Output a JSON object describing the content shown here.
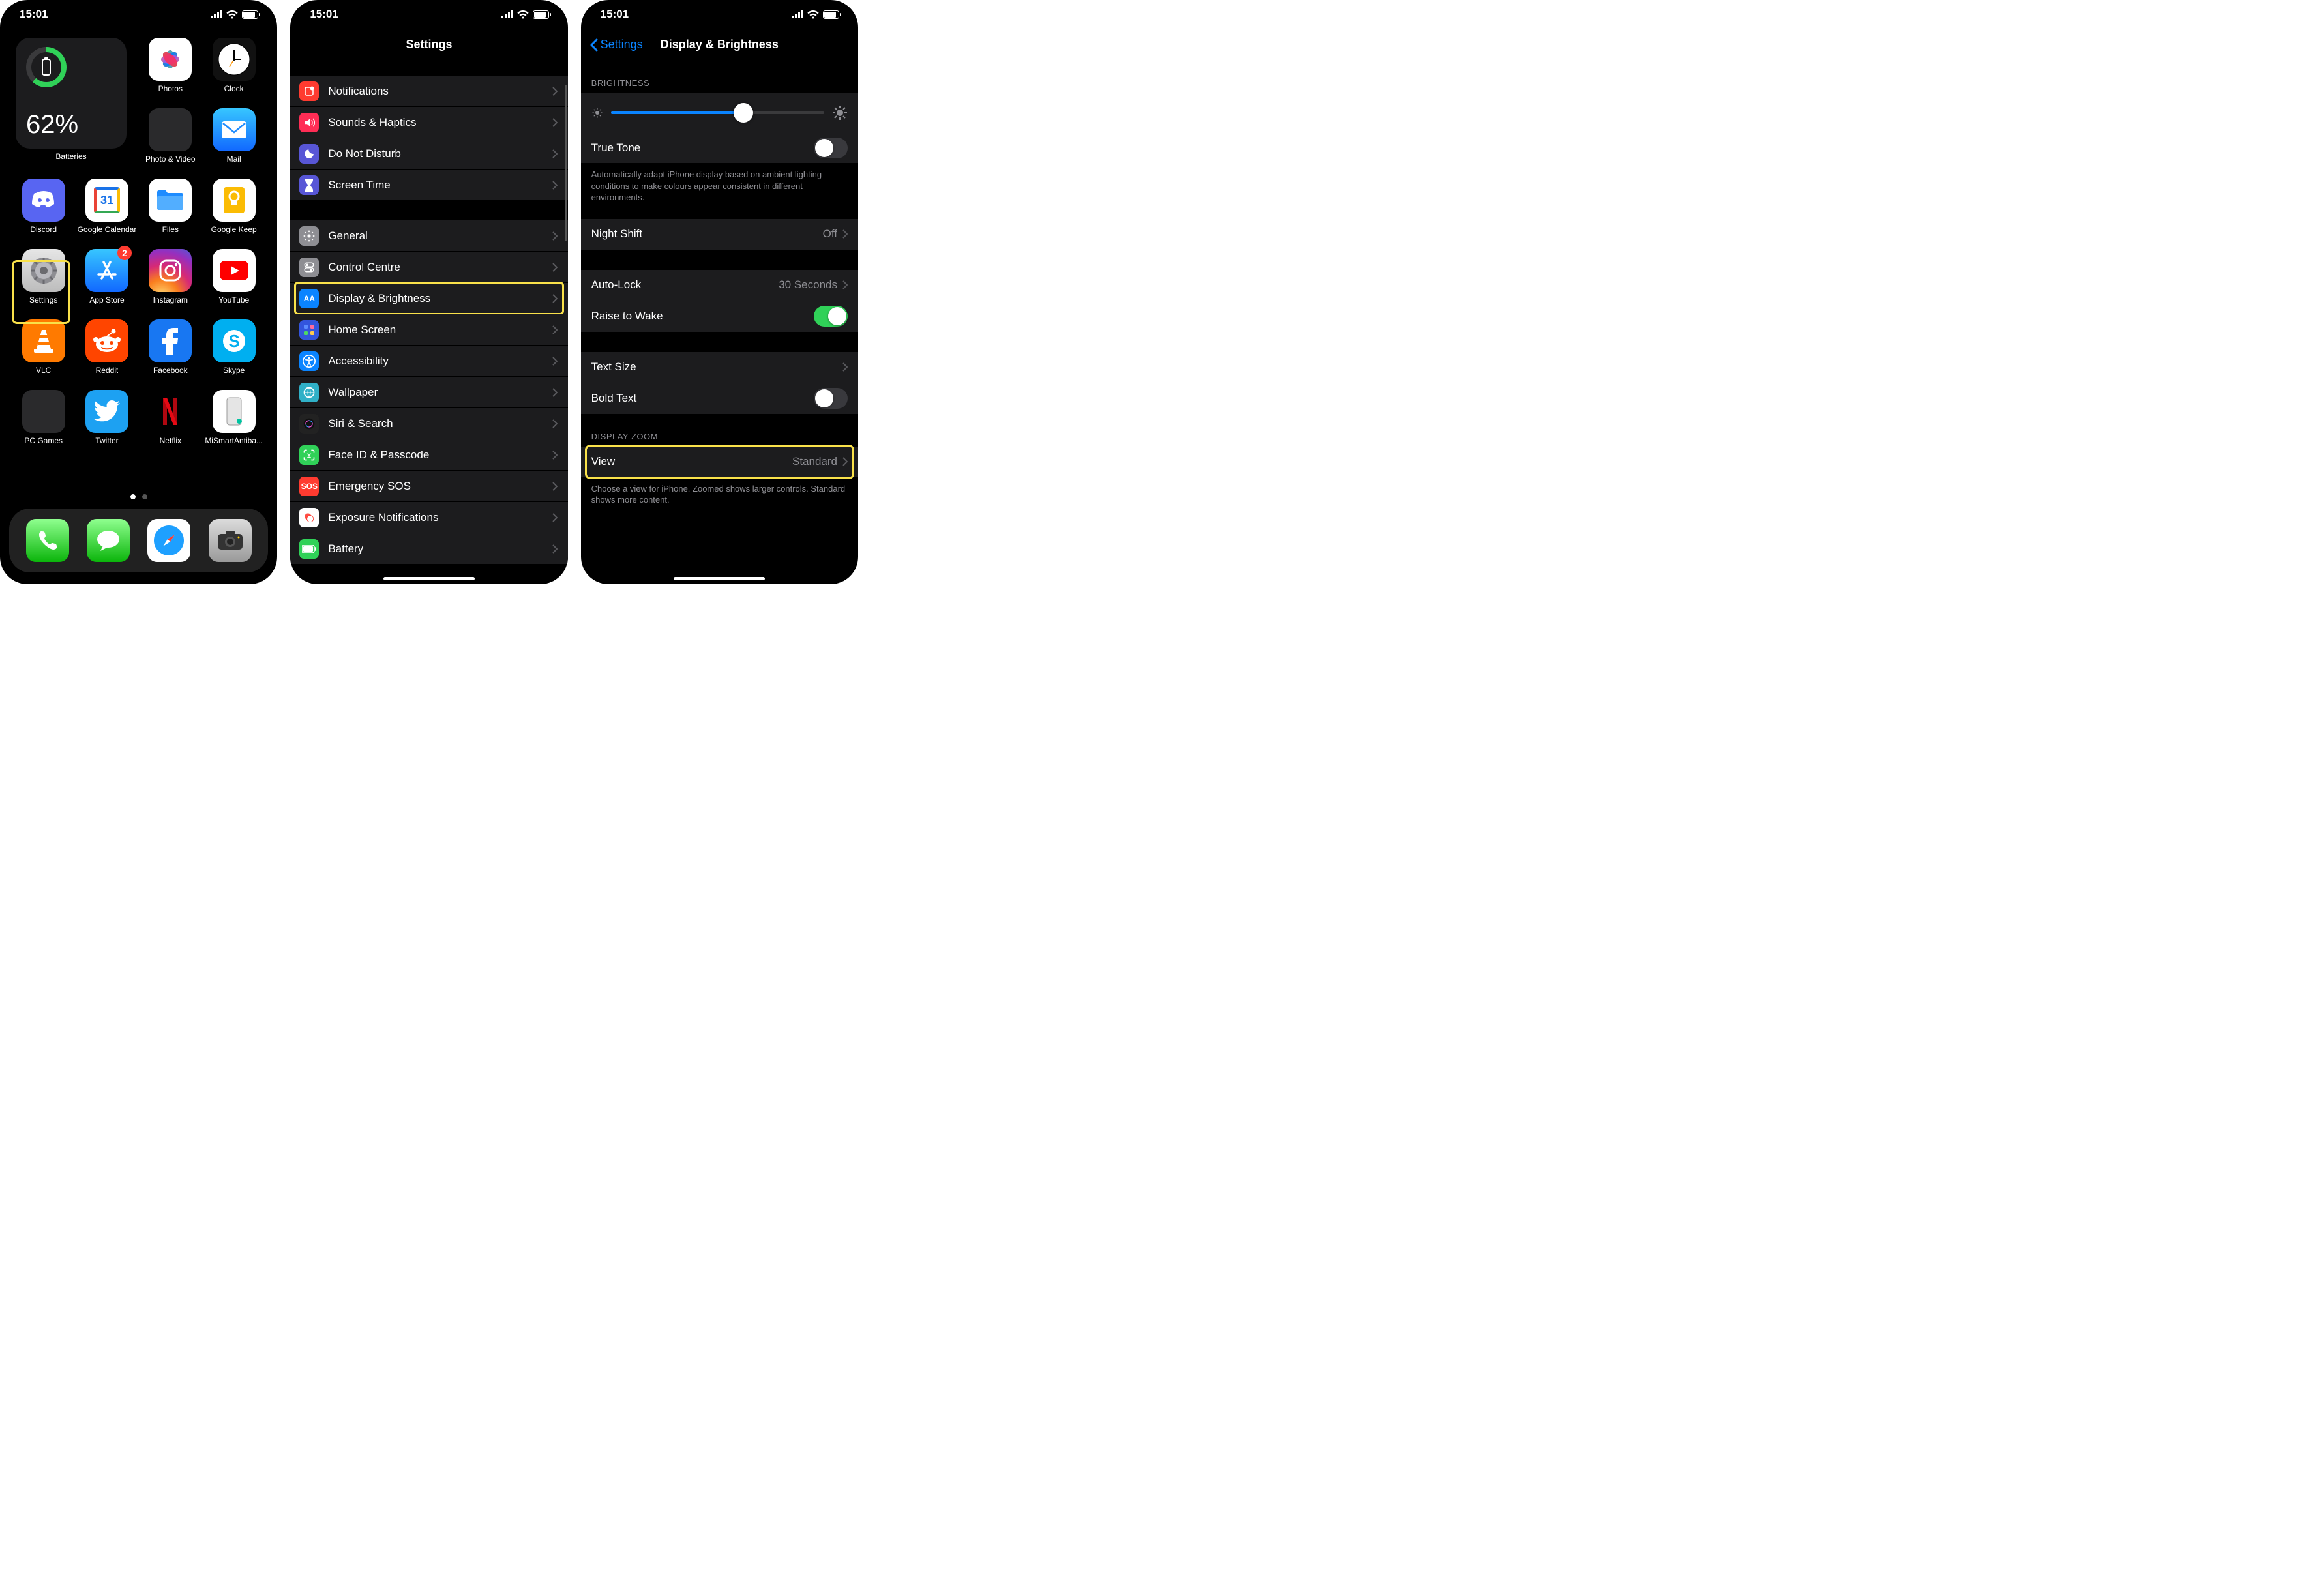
{
  "status": {
    "time": "15:01"
  },
  "home": {
    "battery_widget": {
      "label": "Batteries",
      "percent": "62%",
      "fill_deg": 223
    },
    "apps_row1_right": [
      {
        "id": "photos",
        "label": "Photos",
        "bg": "#ffffff"
      },
      {
        "id": "clock",
        "label": "Clock",
        "bg": "#111111"
      }
    ],
    "apps_row2_right": [
      {
        "id": "photo-video-folder",
        "label": "Photo & Video",
        "folder": true
      },
      {
        "id": "mail",
        "label": "Mail",
        "bg": "#1e8cff"
      }
    ],
    "apps_row3": [
      {
        "id": "discord",
        "label": "Discord",
        "bg": "#5865f2"
      },
      {
        "id": "google-calendar",
        "label": "Google Calendar",
        "bg": "#ffffff"
      },
      {
        "id": "files",
        "label": "Files",
        "bg": "#ffffff"
      },
      {
        "id": "google-keep",
        "label": "Google Keep",
        "bg": "#ffffff"
      }
    ],
    "apps_row4": [
      {
        "id": "settings",
        "label": "Settings",
        "bg": "linear-gradient(#e6e6e6,#bcbcbc)",
        "highlighted": true
      },
      {
        "id": "app-store",
        "label": "App Store",
        "bg": "#1e8cff",
        "badge": "2"
      },
      {
        "id": "instagram",
        "label": "Instagram",
        "bg": "linear-gradient(45deg,#feda75,#d62976,#4f5bd5)"
      },
      {
        "id": "youtube",
        "label": "YouTube",
        "bg": "#ffffff"
      }
    ],
    "apps_row5": [
      {
        "id": "vlc",
        "label": "VLC",
        "bg": "#ff7a00"
      },
      {
        "id": "reddit",
        "label": "Reddit",
        "bg": "#ff4500"
      },
      {
        "id": "facebook",
        "label": "Facebook",
        "bg": "#1877f2"
      },
      {
        "id": "skype",
        "label": "Skype",
        "bg": "#00aff0"
      }
    ],
    "apps_row6": [
      {
        "id": "pc-games-folder",
        "label": "PC Games",
        "folder": true
      },
      {
        "id": "twitter",
        "label": "Twitter",
        "bg": "#1da1f2"
      },
      {
        "id": "netflix",
        "label": "Netflix",
        "bg": "#000000"
      },
      {
        "id": "mi-smart",
        "label": "MiSmartAntiba...",
        "bg": "#ffffff"
      }
    ],
    "dock": [
      {
        "id": "phone",
        "bg": "linear-gradient(#63e562,#0bb50b)"
      },
      {
        "id": "messages",
        "bg": "linear-gradient(#5ff35f,#0bb50b)"
      },
      {
        "id": "safari",
        "bg": "#ffffff"
      },
      {
        "id": "camera",
        "bg": "linear-gradient(#cfcfcf,#9a9a9a)"
      }
    ]
  },
  "settings_list": {
    "title": "Settings",
    "group1": [
      {
        "id": "notifications",
        "label": "Notifications",
        "icon_bg": "#ff3b30"
      },
      {
        "id": "sounds",
        "label": "Sounds & Haptics",
        "icon_bg": "#ff2d55"
      },
      {
        "id": "dnd",
        "label": "Do Not Disturb",
        "icon_bg": "#5856d6"
      },
      {
        "id": "screen-time",
        "label": "Screen Time",
        "icon_bg": "#5856d6"
      }
    ],
    "group2": [
      {
        "id": "general",
        "label": "General",
        "icon_bg": "#8e8e93"
      },
      {
        "id": "control-centre",
        "label": "Control Centre",
        "icon_bg": "#8e8e93"
      },
      {
        "id": "display",
        "label": "Display & Brightness",
        "icon_bg": "#0a84ff",
        "icon_text": "AA",
        "highlighted": true
      },
      {
        "id": "home-screen",
        "label": "Home Screen",
        "icon_bg": "#3355dd"
      },
      {
        "id": "accessibility",
        "label": "Accessibility",
        "icon_bg": "#0a84ff"
      },
      {
        "id": "wallpaper",
        "label": "Wallpaper",
        "icon_bg": "#30b0c7"
      },
      {
        "id": "siri",
        "label": "Siri & Search",
        "icon_bg": "#222222"
      },
      {
        "id": "faceid",
        "label": "Face ID & Passcode",
        "icon_bg": "#30d158"
      },
      {
        "id": "sos",
        "label": "Emergency SOS",
        "icon_bg": "#ff3b30",
        "icon_text": "SOS"
      },
      {
        "id": "exposure",
        "label": "Exposure Notifications",
        "icon_bg": "#ffffff"
      },
      {
        "id": "battery",
        "label": "Battery",
        "icon_bg": "#30d158"
      }
    ]
  },
  "display_page": {
    "back_label": "Settings",
    "title": "Display & Brightness",
    "brightness_header": "BRIGHTNESS",
    "brightness_pct": 62,
    "true_tone": {
      "label": "True Tone",
      "on": false
    },
    "true_tone_footer": "Automatically adapt iPhone display based on ambient lighting conditions to make colours appear consistent in different environments.",
    "night_shift": {
      "label": "Night Shift",
      "value": "Off"
    },
    "auto_lock": {
      "label": "Auto-Lock",
      "value": "30 Seconds"
    },
    "raise_to_wake": {
      "label": "Raise to Wake",
      "on": true
    },
    "text_size": {
      "label": "Text Size"
    },
    "bold_text": {
      "label": "Bold Text",
      "on": false
    },
    "zoom_header": "DISPLAY ZOOM",
    "view": {
      "label": "View",
      "value": "Standard",
      "highlighted": true
    },
    "zoom_footer": "Choose a view for iPhone. Zoomed shows larger controls. Standard shows more content."
  }
}
